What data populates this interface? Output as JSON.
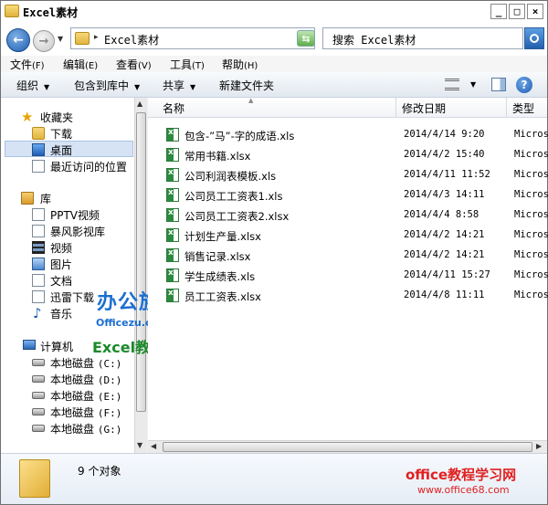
{
  "window": {
    "title": "Excel素材"
  },
  "address": {
    "path": "Excel素材",
    "search_placeholder": "搜索 Excel素材"
  },
  "menu": [
    {
      "label": "文件",
      "key": "(F)"
    },
    {
      "label": "编辑",
      "key": "(E)"
    },
    {
      "label": "查看",
      "key": "(V)"
    },
    {
      "label": "工具",
      "key": "(T)"
    },
    {
      "label": "帮助",
      "key": "(H)"
    }
  ],
  "toolbar": {
    "organize": "组织",
    "include": "包含到库中",
    "share": "共享",
    "new_folder": "新建文件夹"
  },
  "nav": {
    "favorites": "收藏夹",
    "downloads": "下载",
    "desktop": "桌面",
    "recent": "最近访问的位置",
    "libraries": "库",
    "lib_items": [
      "PPTV视频",
      "暴风影视库",
      "视频",
      "图片",
      "文档",
      "迅雷下载",
      "音乐"
    ],
    "computer": "计算机",
    "drives": [
      {
        "label": "本地磁盘",
        "key": "(C:)"
      },
      {
        "label": "本地磁盘",
        "key": "(D:)"
      },
      {
        "label": "本地磁盘",
        "key": "(E:)"
      },
      {
        "label": "本地磁盘",
        "key": "(F:)"
      },
      {
        "label": "本地磁盘",
        "key": "(G:)"
      }
    ]
  },
  "columns": {
    "name": "名称",
    "date": "修改日期",
    "type": "类型"
  },
  "files": [
    {
      "name": "包含-”马”-字的成语.xls",
      "date": "2014/4/14 9:20",
      "type": "Micros"
    },
    {
      "name": "常用书籍.xlsx",
      "date": "2014/4/2 15:40",
      "type": "Micros"
    },
    {
      "name": "公司利润表模板.xls",
      "date": "2014/4/11 11:52",
      "type": "Micros"
    },
    {
      "name": "公司员工工资表1.xls",
      "date": "2014/4/3 14:11",
      "type": "Micros"
    },
    {
      "name": "公司员工工资表2.xlsx",
      "date": "2014/4/4 8:58",
      "type": "Micros"
    },
    {
      "name": "计划生产量.xlsx",
      "date": "2014/4/2 14:21",
      "type": "Micros"
    },
    {
      "name": "销售记录.xlsx",
      "date": "2014/4/2 14:21",
      "type": "Micros"
    },
    {
      "name": "学生成绩表.xls",
      "date": "2014/4/11 15:27",
      "type": "Micros"
    },
    {
      "name": "员工工资表.xlsx",
      "date": "2014/4/8 11:11",
      "type": "Micros"
    }
  ],
  "status": {
    "count": "9 个对象"
  },
  "overlay": {
    "brand_cn": "办公族",
    "brand_url": "Officezu.com",
    "brand_excel": "Excel教程"
  },
  "watermark": {
    "line1": "office教程学习网",
    "line2": "www.office68.com"
  }
}
